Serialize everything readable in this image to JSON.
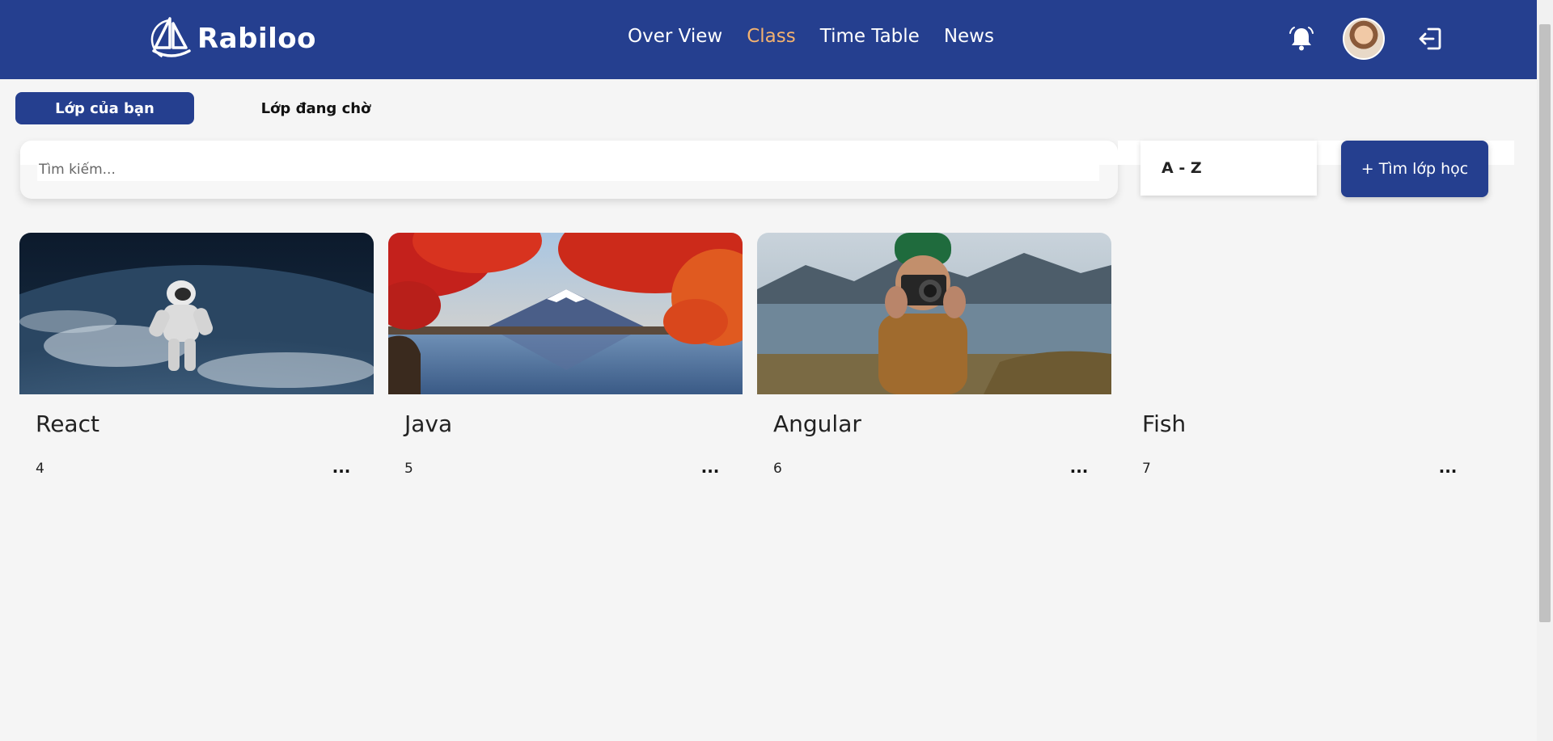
{
  "header": {
    "logo_text": "Rabiloo",
    "nav": [
      {
        "label": "Over View",
        "active": false
      },
      {
        "label": "Class",
        "active": true
      },
      {
        "label": "Time Table",
        "active": false
      },
      {
        "label": "News",
        "active": false
      }
    ],
    "icons": [
      "bell-icon",
      "avatar",
      "logout-icon"
    ]
  },
  "tabs": [
    {
      "label": "Lớp của bạn",
      "active": true
    },
    {
      "label": "Lớp đang chờ",
      "active": false
    }
  ],
  "search": {
    "placeholder": "Tìm kiếm...",
    "value": ""
  },
  "sort": {
    "selected": "A - Z"
  },
  "find_button": {
    "label": "+ Tìm lớp học"
  },
  "classes": [
    {
      "title": "React",
      "count": "4",
      "more": "...",
      "image": "astronaut-over-earth"
    },
    {
      "title": "Java",
      "count": "5",
      "more": "...",
      "image": "mount-fuji-autumn-lake"
    },
    {
      "title": "Angular",
      "count": "6",
      "more": "...",
      "image": "photographer-by-lake"
    },
    {
      "title": "Fish",
      "count": "7",
      "more": "...",
      "image": ""
    }
  ],
  "colors": {
    "header_bg": "#253f8f",
    "nav_active": "#f4b26f",
    "primary": "#253f8f",
    "page_bg": "#f5f5f5"
  }
}
